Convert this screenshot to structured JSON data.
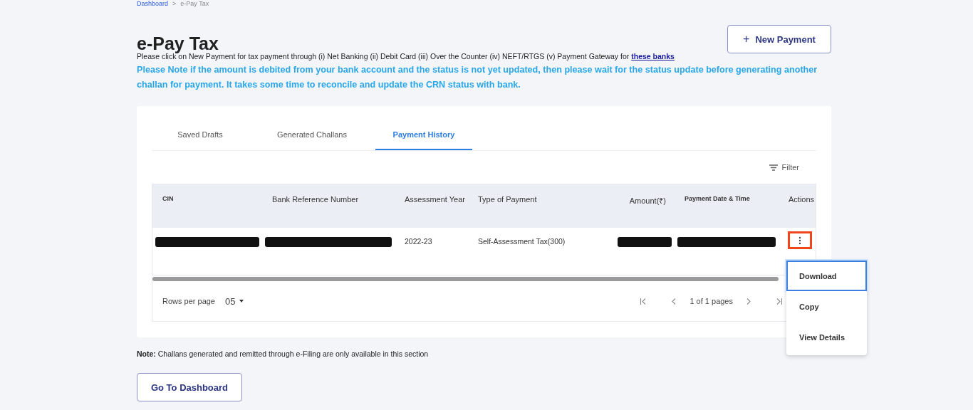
{
  "breadcrumb": {
    "items": [
      "Dashboard",
      "e-Pay Tax"
    ],
    "separator": ">"
  },
  "title": "e-Pay Tax",
  "new_payment_button": {
    "icon": "+",
    "label": "New Payment"
  },
  "instruction": {
    "text": "Please click on New Payment for tax payment through (i) Net Banking (ii) Debit Card (iii) Over the Counter (iv) NEFT/RTGS (v) Payment Gateway for",
    "link": "these banks"
  },
  "notice": "Please Note if the amount is debited from your bank account and the status is not yet updated, then please wait for the status update before generating another challan for payment. It takes some time to reconcile and update the CRN status with bank.",
  "tabs": [
    {
      "label": "Saved Drafts",
      "selected": false
    },
    {
      "label": "Generated Challans",
      "selected": false
    },
    {
      "label": "Payment History",
      "selected": true
    }
  ],
  "filter": "Filter",
  "table": {
    "columns": [
      "CIN",
      "Bank Reference Number",
      "Assessment Year",
      "Type of Payment",
      "Amount(₹)",
      "Payment Date & Time",
      "Actions"
    ],
    "rows": [
      {
        "cells": [
          {
            "kind": "redacted"
          },
          {
            "kind": "redacted"
          },
          {
            "kind": "text",
            "text": "2022-23"
          },
          {
            "kind": "text",
            "text": "Self-Assessment Tax(300)"
          },
          {
            "kind": "redacted"
          },
          {
            "kind": "redacted"
          }
        ],
        "actions_highlighted": true
      }
    ]
  },
  "pagination": {
    "rows_per_page_label": "Rows per page",
    "rows_per_page": "05",
    "page_info": "1 of 1 pages"
  },
  "action_menu": [
    {
      "label": "Download",
      "selected": true
    },
    {
      "label": "Copy",
      "selected": false
    },
    {
      "label": "View Details",
      "selected": false
    }
  ],
  "note": {
    "label": "Note:",
    "text": "Challans generated and remitted through e-Filing are only available in this section"
  },
  "dashboard_button": "Go To Dashboard"
}
